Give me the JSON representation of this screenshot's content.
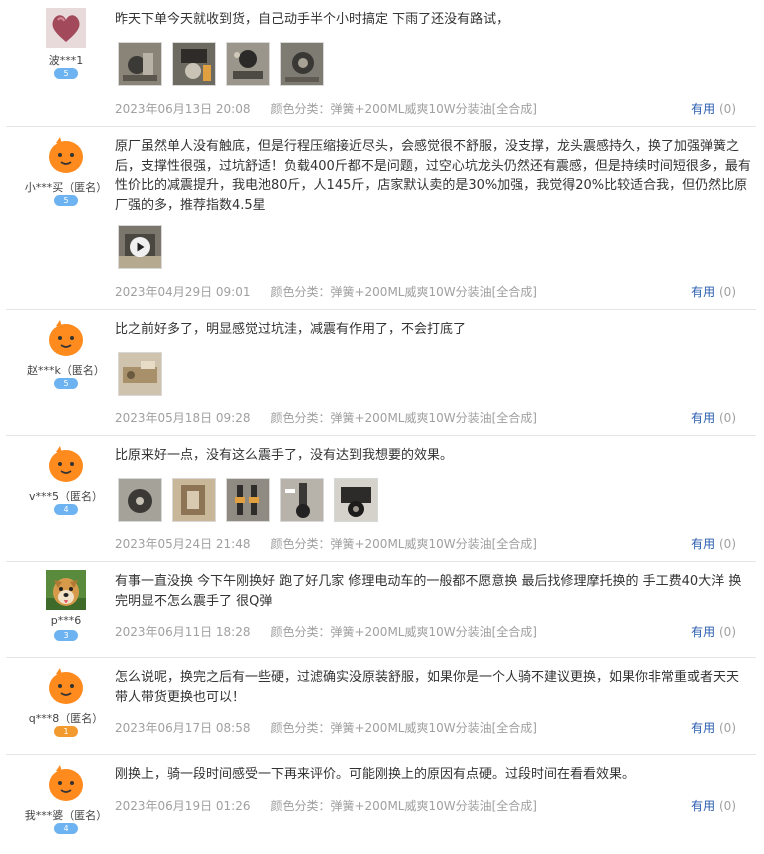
{
  "reviews": [
    {
      "user": "波***1",
      "level": "5",
      "text": "昨天下单今天就收到货，自己动手半个小时搞定 下雨了还没有路试，",
      "date": "2023年06月13日 20:08",
      "sku": "颜色分类：弹簧+200ML威爽10W分装油[全合成]",
      "useful_label": "有用",
      "useful_count": "(0)"
    },
    {
      "user": "小***买（匿名）",
      "level": "5",
      "text": "原厂虽然单人没有触底，但是行程压缩接近尽头，会感觉很不舒服，没支撑，龙头震感持久，换了加强弹簧之后，支撑性很强，过坑舒适！负载400斤都不是问题，过空心坑龙头仍然还有震感，但是持续时间短很多，最有性价比的减震提升，我电池80斤，人145斤，店家默认卖的是30%加强，我觉得20%比较适合我，但仍然比原厂强的多，推荐指数4.5星",
      "date": "2023年04月29日 09:01",
      "sku": "颜色分类：弹簧+200ML威爽10W分装油[全合成]",
      "useful_label": "有用",
      "useful_count": "(0)"
    },
    {
      "user": "赵***k（匿名）",
      "level": "5",
      "text": "比之前好多了，明显感觉过坑洼，减震有作用了，不会打底了",
      "date": "2023年05月18日 09:28",
      "sku": "颜色分类：弹簧+200ML威爽10W分装油[全合成]",
      "useful_label": "有用",
      "useful_count": "(0)"
    },
    {
      "user": "v***5（匿名）",
      "level": "4",
      "text": "比原来好一点，没有这么震手了，没有达到我想要的效果。",
      "date": "2023年05月24日 21:48",
      "sku": "颜色分类：弹簧+200ML威爽10W分装油[全合成]",
      "useful_label": "有用",
      "useful_count": "(0)"
    },
    {
      "user": "p***6",
      "level": "3",
      "text": "有事一直没换 今下午刚换好 跑了好几家 修理电动车的一般都不愿意换 最后找修理摩托换的 手工费40大洋 换完明显不怎么震手了 很Q弹",
      "date": "2023年06月11日 18:28",
      "sku": "颜色分类：弹簧+200ML威爽10W分装油[全合成]",
      "useful_label": "有用",
      "useful_count": "(0)"
    },
    {
      "user": "q***8（匿名）",
      "level": "1",
      "text": "怎么说呢，换完之后有一些硬，过滤确实没原装舒服，如果你是一个人骑不建议更换，如果你非常重或者天天带人带货更换也可以！",
      "date": "2023年06月17日 08:58",
      "sku": "颜色分类：弹簧+200ML威爽10W分装油[全合成]",
      "useful_label": "有用",
      "useful_count": "(0)"
    },
    {
      "user": "我***婆（匿名）",
      "level": "4",
      "text": "刚换上，骑一段时间感受一下再来评价。可能刚换上的原因有点硬。过段时间在看看效果。",
      "date": "2023年06月19日 01:26",
      "sku": "颜色分类：弹簧+200ML威爽10W分装油[全合成]",
      "useful_label": "有用",
      "useful_count": "(0)"
    }
  ],
  "icons": {
    "play": "play-icon",
    "level_badge": "diamond-level-icon"
  },
  "colors": {
    "useful_link": "#2a5db0",
    "meta_text": "#a0a0a0",
    "level_badge": "#6db3f2",
    "level_badge_gold": "#f29a2e",
    "default_avatar": "#ff8a1e"
  }
}
